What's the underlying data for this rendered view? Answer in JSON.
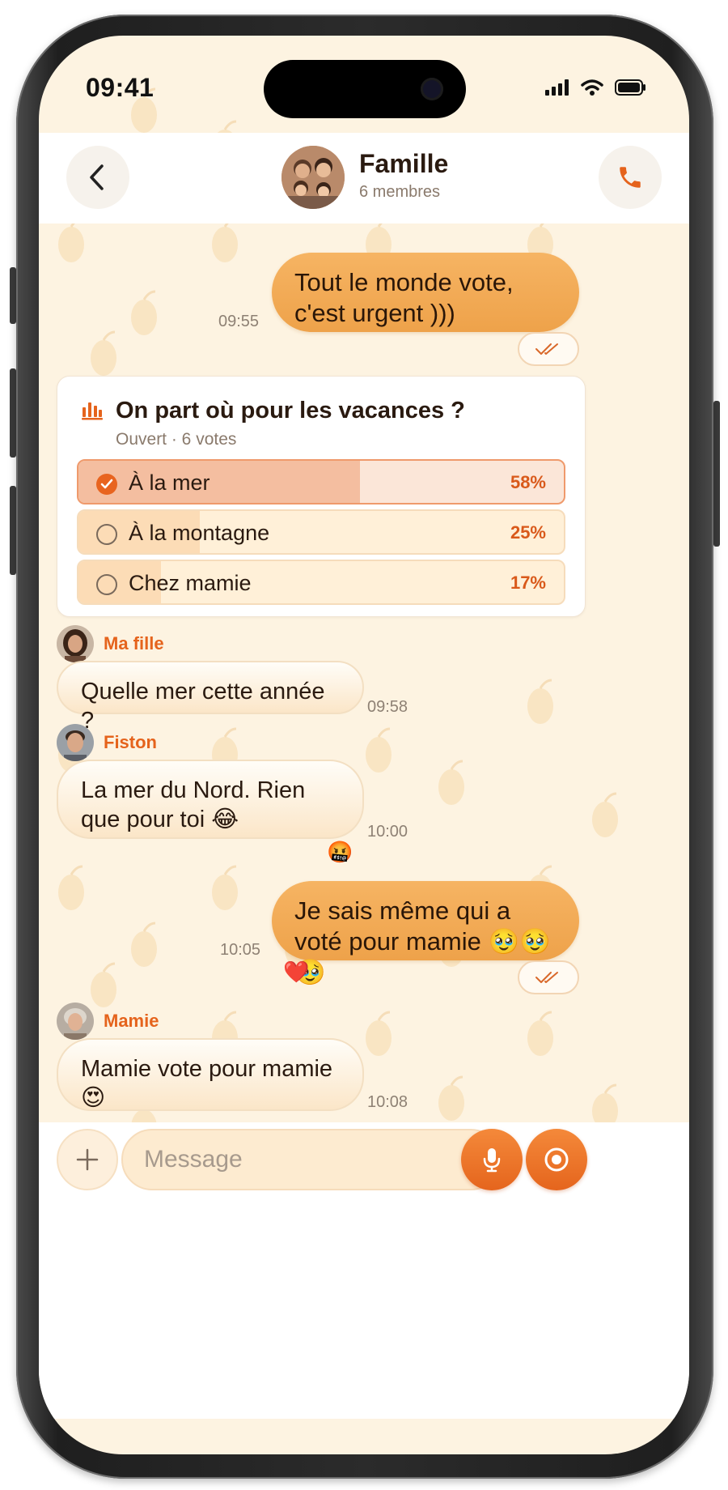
{
  "status_bar": {
    "time": "09:41"
  },
  "header": {
    "back_icon": "chevron-left-icon",
    "title": "Famille",
    "subtitle": "6 membres",
    "call_icon": "phone-icon",
    "accent": "#e5631c"
  },
  "messages": [
    {
      "direction": "out",
      "text": "Tout le monde vote, c'est urgent )))",
      "time": "09:55",
      "read_icon": "double-check-icon"
    },
    {
      "direction": "out",
      "text": "Je sais même qui a voté pour mamie 🥹🥹🥹",
      "time": "10:05",
      "reaction": "❤️",
      "read_icon": "double-check-icon"
    }
  ],
  "poll": {
    "icon": "poll-chart-icon",
    "question": "On part où pour les vacances ?",
    "status": "Ouvert · 6 votes",
    "options": [
      {
        "label": "À la mer",
        "percent": "58%",
        "value": 58,
        "selected": true
      },
      {
        "label": "À la montagne",
        "percent": "25%",
        "value": 25,
        "selected": false
      },
      {
        "label": "Chez mamie",
        "percent": "17%",
        "value": 17,
        "selected": false
      }
    ]
  },
  "incoming": [
    {
      "sender": "Ma fille",
      "text": "Quelle mer cette année ?",
      "time": "09:58"
    },
    {
      "sender": "Fiston",
      "text": "La mer du Nord. Rien que pour toi 😂",
      "time": "10:00",
      "reaction": "🤬"
    },
    {
      "sender": "Mamie",
      "text": "Mamie vote pour mamie 😍",
      "time": "10:08"
    }
  ],
  "composer": {
    "placeholder": "Message",
    "add_icon": "plus-icon",
    "mic_icon": "microphone-icon",
    "camera_icon": "record-circle-icon"
  }
}
